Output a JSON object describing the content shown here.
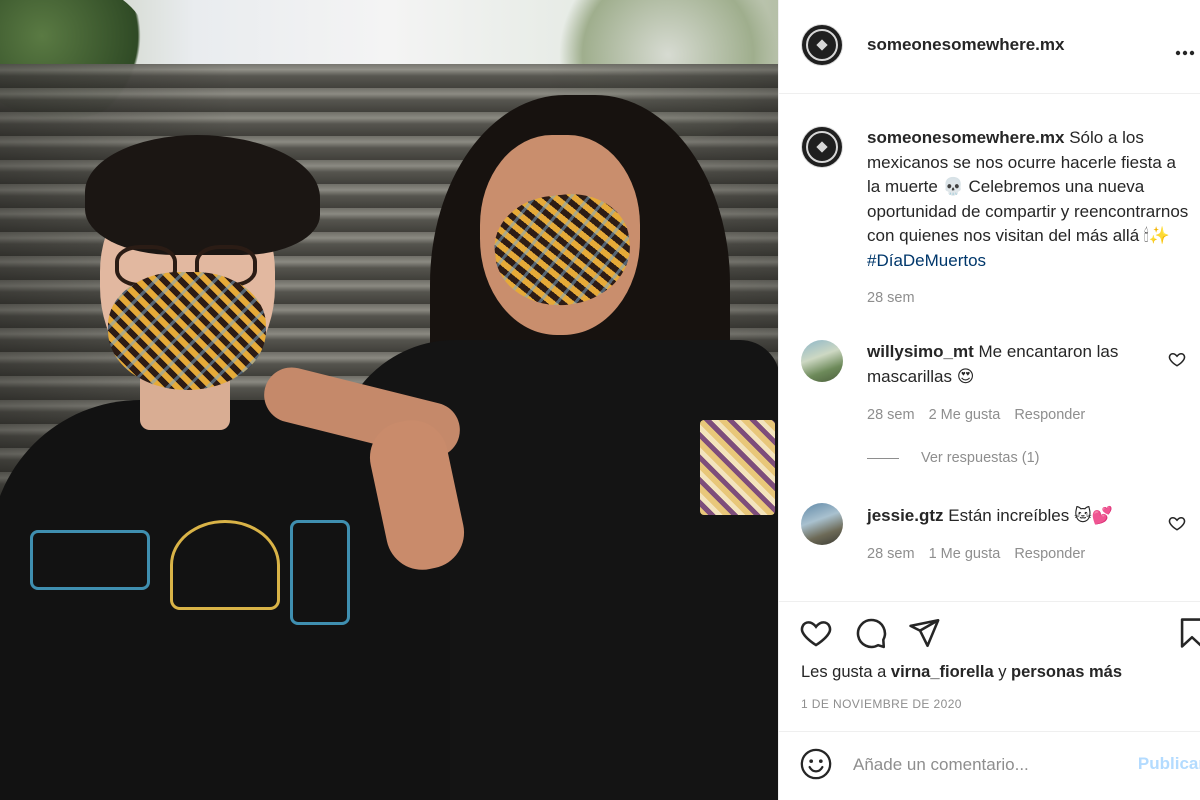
{
  "post": {
    "username": "someonesomewhere.mx",
    "more_icon": "more-horizontal-icon",
    "photo_alt": "Dos personas con cubrebocas bordados en una escalinata"
  },
  "caption": {
    "username": "someonesomewhere.mx",
    "text": " Sólo a los mexicanos se nos ocurre hacerle fiesta a la muerte 💀 Celebremos una nueva oportunidad de compartir y reencontrarnos con quienes nos visitan del más allá 🕯✨ ",
    "hashtag": "#DíaDeMuertos",
    "age": "28 sem"
  },
  "comments": [
    {
      "username": "willysimo_mt",
      "text": " Me encantaron las mascarillas 😍",
      "age": "28 sem",
      "likes": "2 Me gusta",
      "reply": "Responder"
    },
    {
      "username": "jessie.gtz",
      "text": " Están increíbles 🐱💕",
      "age": "28 sem",
      "likes": "1 Me gusta",
      "reply": "Responder"
    }
  ],
  "view_replies": "Ver respuestas (1)",
  "actions": {
    "liked_by_prefix": "Les gusta a ",
    "liked_by_user": "virna_fiorella",
    "liked_by_mid": " y ",
    "liked_by_more": "personas más",
    "date": "1 de noviembre de 2020"
  },
  "add_comment": {
    "placeholder": "Añade un comentario...",
    "post_label": "Publicar"
  },
  "colors": {
    "text": "#262626",
    "secondary": "#8e8e8e",
    "hashtag": "#00376b",
    "post_button": "#b3dbff",
    "divider": "#efefef"
  }
}
